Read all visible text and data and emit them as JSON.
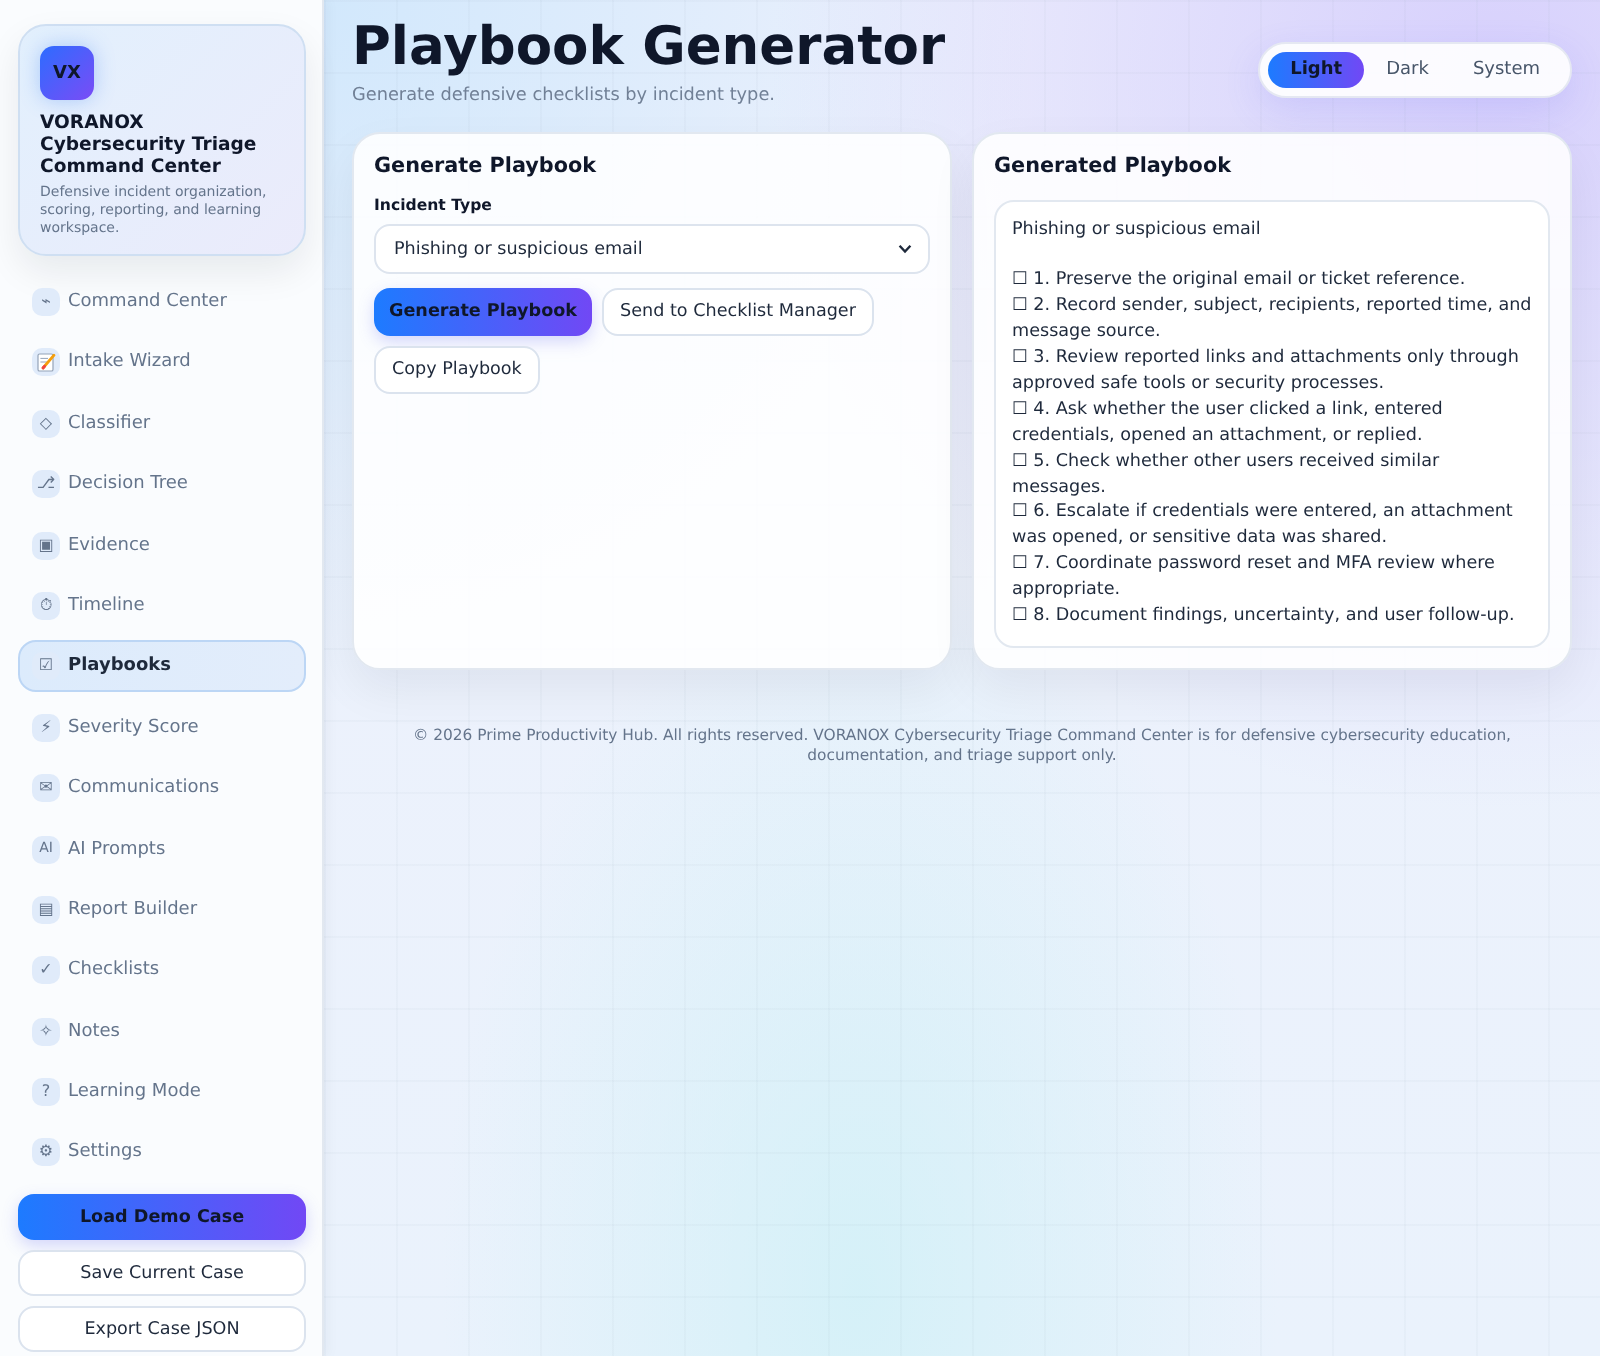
{
  "sidebar": {
    "brand": {
      "logo": "VX",
      "title": "VORANOX Cybersecurity Triage Command Center",
      "description": "Defensive incident organization, scoring, reporting, and learning workspace."
    },
    "nav": [
      {
        "icon": "⌁",
        "label": "Command Center",
        "selected": false
      },
      {
        "label": "Intake Wizard",
        "selected": false
      },
      {
        "icon": "◇",
        "label": "Classifier",
        "selected": false
      },
      {
        "icon": "⎇",
        "label": "Decision Tree",
        "selected": false
      },
      {
        "icon": "▣",
        "label": "Evidence",
        "selected": false
      },
      {
        "icon": "⏱",
        "label": "Timeline",
        "selected": false
      },
      {
        "icon": "☑",
        "label": "Playbooks",
        "selected": true
      },
      {
        "icon": "⚡",
        "label": "Severity Score",
        "selected": false
      },
      {
        "icon": "✉",
        "label": "Communications",
        "selected": false
      },
      {
        "icon": "AI",
        "label": "AI Prompts",
        "selected": false
      },
      {
        "icon": "▤",
        "label": "Report Builder",
        "selected": false
      },
      {
        "icon": "✓",
        "label": "Checklists",
        "selected": false
      },
      {
        "icon": "✧",
        "label": "Notes",
        "selected": false
      },
      {
        "icon": "?",
        "label": "Learning Mode",
        "selected": false
      },
      {
        "icon": "⚙",
        "label": "Settings",
        "selected": false
      }
    ],
    "actions": [
      {
        "label": "Load Demo Case",
        "kind": "primary"
      },
      {
        "label": "Save Current Case",
        "kind": "secondary"
      },
      {
        "label": "Export Case JSON",
        "kind": "secondary"
      }
    ]
  },
  "header": {
    "title": "Playbook Generator",
    "subtitle": "Generate defensive checklists by incident type.",
    "theme_options": [
      {
        "label": "Light",
        "selected": true
      },
      {
        "label": "Dark",
        "selected": false
      },
      {
        "label": "System",
        "selected": false
      }
    ]
  },
  "generator": {
    "title": "Generate Playbook",
    "field_label": "Incident Type",
    "incident_type": "Phishing or suspicious email",
    "buttons": [
      {
        "label": "Generate Playbook",
        "kind": "primary"
      },
      {
        "label": "Send to Checklist Manager",
        "kind": "secondary"
      },
      {
        "label": "Copy Playbook",
        "kind": "secondary"
      }
    ]
  },
  "output": {
    "title": "Generated Playbook",
    "heading": "Phishing or suspicious email",
    "items": [
      "☐ 1. Preserve the original email or ticket reference.",
      "☐ 2. Record sender, subject, recipients, reported time, and message source.",
      "☐ 3. Review reported links and attachments only through approved safe tools or security processes.",
      "☐ 4. Ask whether the user clicked a link, entered credentials, opened an attachment, or replied.",
      "☐ 5. Check whether other users received similar messages.",
      "☐ 6. Escalate if credentials were entered, an attachment was opened, or sensitive data was shared.",
      "☐ 7. Coordinate password reset and MFA review where appropriate.",
      "☐ 8. Document findings, uncertainty, and user follow-up."
    ]
  },
  "footer": "© 2026 Prime Productivity Hub. All rights reserved. VORANOX Cybersecurity Triage Command Center is for defensive cybersecurity education, documentation, and triage support only."
}
